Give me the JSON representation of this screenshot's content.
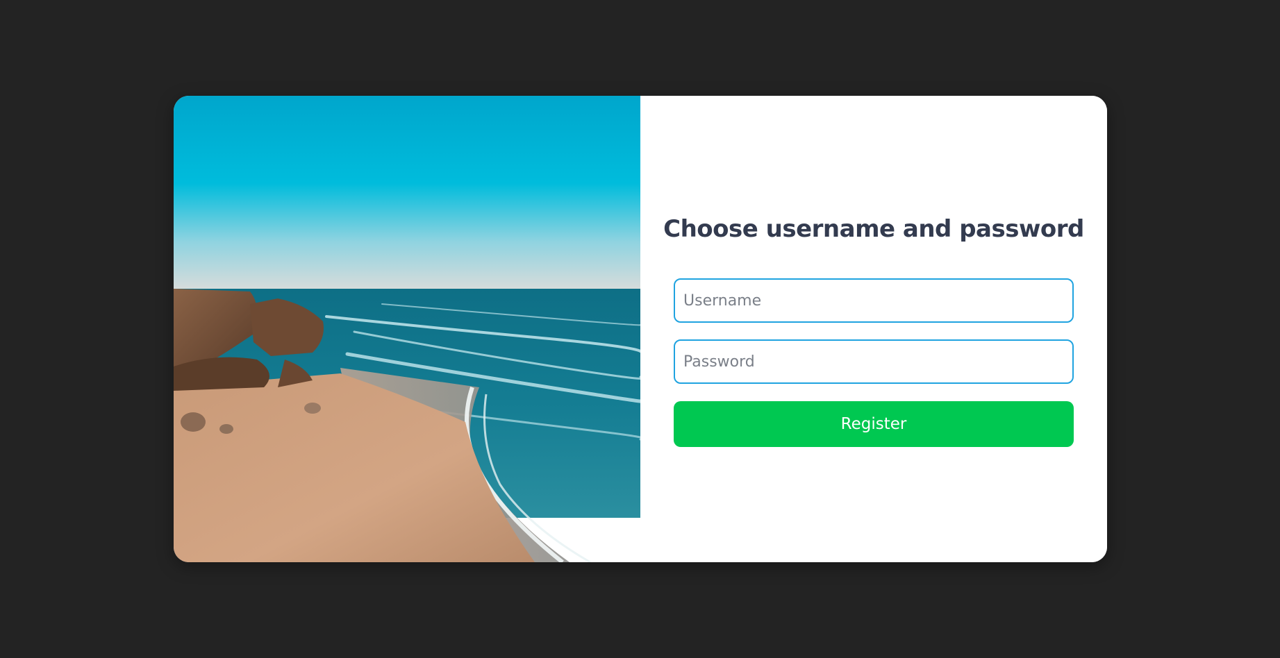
{
  "form": {
    "title": "Choose username and password",
    "username_placeholder": "Username",
    "password_placeholder": "Password",
    "submit_label": "Register"
  },
  "colors": {
    "page_background": "#232323",
    "card_background": "#ffffff",
    "title_text": "#333b4f",
    "field_border": "#1fa3e0",
    "button_background": "#00c851",
    "button_text": "#ffffff"
  }
}
